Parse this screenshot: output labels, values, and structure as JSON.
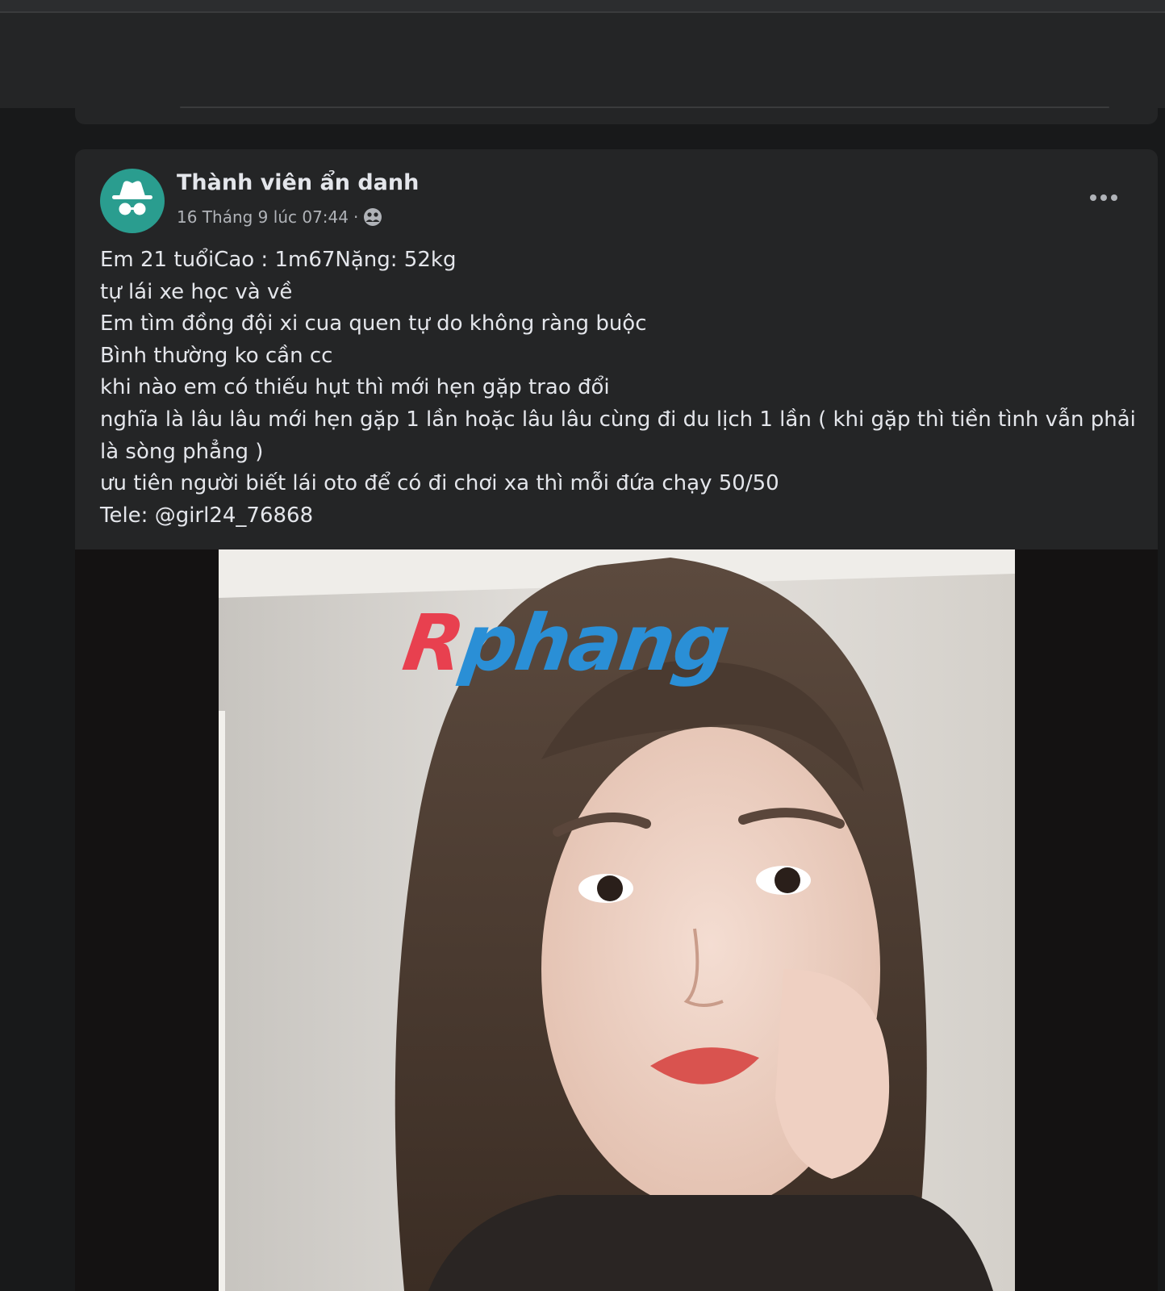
{
  "post": {
    "author": "Thành viên ẩn danh",
    "date": "16 Tháng 9 lúc 07:44",
    "separator": "·",
    "privacy_icon": "group-privacy-icon",
    "more_icon": "more-options-icon",
    "lines": [
      "Em 21 tuổiCao : 1m67Nặng: 52kg",
      "tự lái xe học và về",
      "Em tìm đồng đội xi cua quen tự do không ràng buộc",
      "Bình thường ko cần cc",
      "khi nào em có thiếu hụt thì mới hẹn gặp trao đổi",
      "nghĩa là lâu lâu mới hẹn gặp 1 lần hoặc lâu lâu cùng đi du lịch 1 lần ( khi gặp thì tiền tình vẫn phải là sòng phẳng )",
      "ưu tiên người biết lái oto để có đi chơi xa thì mỗi đứa chạy 50/50",
      "Tele: @girl24_76868"
    ]
  },
  "photo": {
    "watermark": "Rphang"
  },
  "colors": {
    "page_background": "#18191a",
    "card_background": "#242526",
    "avatar_background": "#2a9d8f",
    "primary_text": "#e4e6eb",
    "secondary_text": "#b0b3b8",
    "watermark_red": "#e8404f",
    "watermark_blue": "#2a8fd6"
  }
}
